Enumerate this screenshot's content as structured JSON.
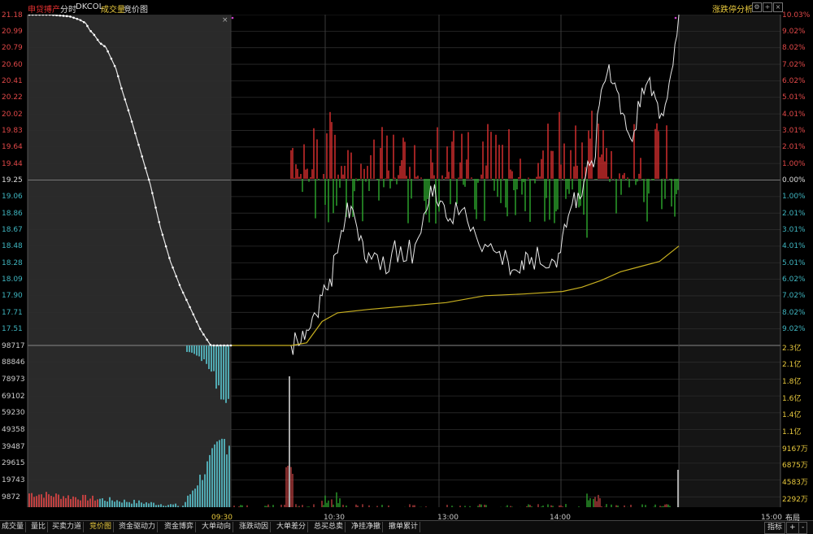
{
  "header": {
    "tag": "申贷搏产",
    "mode": "分时",
    "code": "DKCOL",
    "volume_label": "成交量",
    "bid_label": "竞价图",
    "analysis_label": "涨跌停分析"
  },
  "colors": {
    "up": "#e03030",
    "down": "#2eaa2e",
    "price_axis_up": "#e04848",
    "price_axis_down": "#3fb5c0",
    "avg_line": "#c8b020",
    "price_line": "#e8e8e8",
    "accent": "#e8c93e"
  },
  "price_axis": {
    "left": [
      "21.18",
      "20.99",
      "20.79",
      "20.60",
      "20.41",
      "20.22",
      "20.02",
      "19.83",
      "19.64",
      "19.44",
      "19.25",
      "19.06",
      "18.86",
      "18.67",
      "18.48",
      "18.28",
      "18.09",
      "17.90",
      "17.71",
      "17.51"
    ],
    "right": [
      "10.03%",
      "9.02%",
      "8.02%",
      "7.02%",
      "6.02%",
      "5.01%",
      "4.01%",
      "3.01%",
      "2.01%",
      "1.00%",
      "0.00%",
      "1.00%",
      "2.01%",
      "3.01%",
      "4.01%",
      "5.01%",
      "6.02%",
      "7.02%",
      "8.02%",
      "9.02%"
    ]
  },
  "volume_axis": {
    "left": [
      "98717",
      "88846",
      "78973",
      "69102",
      "59230",
      "49358",
      "39487",
      "29615",
      "19743",
      "9872"
    ],
    "right": [
      "2.3亿",
      "2.1亿",
      "1.8亿",
      "1.6亿",
      "1.4亿",
      "1.1亿",
      "9167万",
      "6875万",
      "4583万",
      "2292万"
    ]
  },
  "time_axis": [
    "09:30",
    "10:30",
    "13:00",
    "14:00",
    "15:00"
  ],
  "bottom_tabs": [
    "成交量",
    "量比",
    "买卖力道",
    "竞价图",
    "资金驱动力",
    "资金博弈",
    "大单动向",
    "涨跌动因",
    "大单差分",
    "总买总卖",
    "净挂净撤",
    "撤单累计"
  ],
  "active_tab": "竞价图",
  "right_buttons": {
    "layout": "布局",
    "indicator": "指标",
    "plus": "+",
    "minus": "-"
  },
  "chart_data": {
    "type": "line",
    "title": "",
    "price_range": [
      17.32,
      21.18
    ],
    "prev_close": 19.25,
    "auction_price_path": [
      [
        0,
        21.18
      ],
      [
        0.05,
        21.18
      ],
      [
        0.1,
        21.18
      ],
      [
        0.15,
        21.17
      ],
      [
        0.2,
        21.16
      ],
      [
        0.25,
        21.12
      ],
      [
        0.28,
        21.08
      ],
      [
        0.3,
        21.0
      ],
      [
        0.32,
        20.95
      ],
      [
        0.35,
        20.85
      ],
      [
        0.38,
        20.8
      ],
      [
        0.4,
        20.7
      ],
      [
        0.43,
        20.55
      ],
      [
        0.46,
        20.3
      ],
      [
        0.5,
        20.0
      ],
      [
        0.55,
        19.6
      ],
      [
        0.6,
        19.2
      ],
      [
        0.65,
        18.7
      ],
      [
        0.7,
        18.3
      ],
      [
        0.75,
        18.0
      ],
      [
        0.8,
        17.75
      ],
      [
        0.85,
        17.5
      ],
      [
        0.9,
        17.32
      ],
      [
        1.0,
        17.32
      ]
    ],
    "intraday_price_path": [
      [
        0,
        17.32
      ],
      [
        0.02,
        17.32
      ],
      [
        0.04,
        17.5
      ],
      [
        0.06,
        17.7
      ],
      [
        0.08,
        17.9
      ],
      [
        0.1,
        18.1
      ],
      [
        0.12,
        18.4
      ],
      [
        0.14,
        18.8
      ],
      [
        0.16,
        18.9
      ],
      [
        0.18,
        18.6
      ],
      [
        0.2,
        18.4
      ],
      [
        0.23,
        18.2
      ],
      [
        0.26,
        18.4
      ],
      [
        0.29,
        18.3
      ],
      [
        0.32,
        18.5
      ],
      [
        0.35,
        18.9
      ],
      [
        0.37,
        19.2
      ],
      [
        0.39,
        19.0
      ],
      [
        0.41,
        18.8
      ],
      [
        0.44,
        18.9
      ],
      [
        0.47,
        18.7
      ],
      [
        0.5,
        18.5
      ],
      [
        0.53,
        18.4
      ],
      [
        0.56,
        18.3
      ],
      [
        0.58,
        18.2
      ],
      [
        0.6,
        18.2
      ],
      [
        0.62,
        18.35
      ],
      [
        0.65,
        18.25
      ],
      [
        0.68,
        18.3
      ],
      [
        0.7,
        18.6
      ],
      [
        0.72,
        18.9
      ],
      [
        0.74,
        19.1
      ],
      [
        0.76,
        19.3
      ],
      [
        0.78,
        19.4
      ],
      [
        0.8,
        20.3
      ],
      [
        0.82,
        20.6
      ],
      [
        0.84,
        20.3
      ],
      [
        0.86,
        20.0
      ],
      [
        0.88,
        19.7
      ],
      [
        0.9,
        20.1
      ],
      [
        0.92,
        20.4
      ],
      [
        0.94,
        20.2
      ],
      [
        0.96,
        20.0
      ],
      [
        0.98,
        20.5
      ],
      [
        1.0,
        21.18
      ]
    ],
    "avg_price_path": [
      [
        0,
        17.32
      ],
      [
        0.04,
        17.35
      ],
      [
        0.08,
        17.6
      ],
      [
        0.12,
        17.7
      ],
      [
        0.2,
        17.74
      ],
      [
        0.3,
        17.78
      ],
      [
        0.4,
        17.82
      ],
      [
        0.5,
        17.9
      ],
      [
        0.6,
        17.92
      ],
      [
        0.7,
        17.95
      ],
      [
        0.75,
        18.0
      ],
      [
        0.8,
        18.08
      ],
      [
        0.85,
        18.18
      ],
      [
        0.9,
        18.24
      ],
      [
        0.95,
        18.3
      ],
      [
        1.0,
        18.48
      ]
    ]
  }
}
